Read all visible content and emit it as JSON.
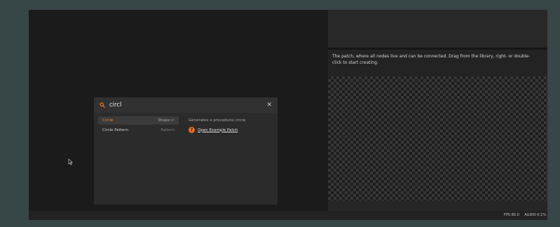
{
  "search": {
    "query": "circl",
    "results": [
      {
        "name": "Circle",
        "category": "Shape",
        "shortcut": "↵"
      },
      {
        "name": "Circle Pattern",
        "category": "Pattern"
      }
    ],
    "details": {
      "description": "Generates a procedural circle",
      "example_link": "Open Example Patch"
    }
  },
  "right_panel": {
    "description": "The patch, where all nodes live and can be connected. Drag from the library, right- or double-click to start creating."
  },
  "status": {
    "fps": "FPS 60.0",
    "audio": "AUDIO 0.1%"
  },
  "colors": {
    "accent": "#e97a24",
    "background": "#374647"
  }
}
